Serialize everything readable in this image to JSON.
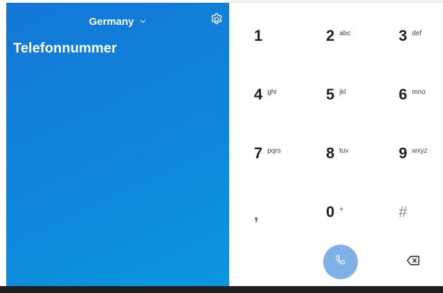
{
  "header": {
    "country": "Germany",
    "title": "Telefonnummer"
  },
  "icons": {
    "country_dropdown": "chevron-down-icon",
    "settings": "gear-icon",
    "call": "phone-icon",
    "backspace": "backspace-icon"
  },
  "dialpad": {
    "keys": [
      {
        "digit": "1",
        "letters": ""
      },
      {
        "digit": "2",
        "letters": "abc"
      },
      {
        "digit": "3",
        "letters": "def"
      },
      {
        "digit": "4",
        "letters": "ghi"
      },
      {
        "digit": "5",
        "letters": "jkl"
      },
      {
        "digit": "6",
        "letters": "mno"
      },
      {
        "digit": "7",
        "letters": "pqrs"
      },
      {
        "digit": "8",
        "letters": "tuv"
      },
      {
        "digit": "9",
        "letters": "wxyz"
      },
      {
        "digit": ",",
        "letters": ""
      },
      {
        "digit": "0",
        "letters": "+"
      },
      {
        "digit": "#",
        "letters": ""
      }
    ]
  },
  "colors": {
    "panel_top": "#1377d6",
    "panel_bottom": "#0b97df",
    "call_button": "#7fb1e6"
  }
}
